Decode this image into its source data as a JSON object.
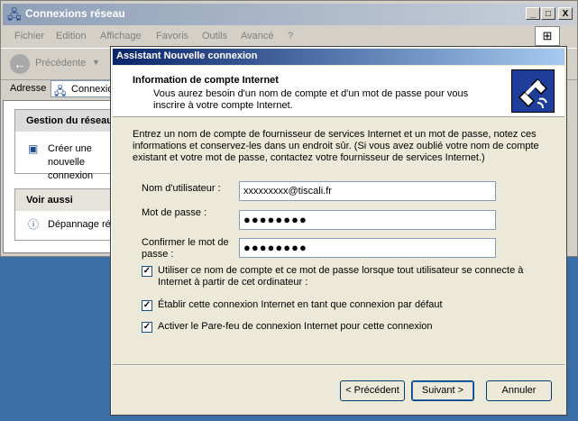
{
  "bg_window": {
    "title": "Connexions réseau",
    "minimize": "_",
    "maximize": "□",
    "close": "X",
    "menu": [
      "Fichier",
      "Edition",
      "Affichage",
      "Favoris",
      "Outils",
      "Avancé",
      "?"
    ],
    "back_label": "Précédente",
    "address_label": "Adresse",
    "address_value": "Connexio",
    "task_panel_title": "Gestion du réseau",
    "task_create": "Créer une nouvelle connexion",
    "see_also_title": "Voir aussi",
    "see_also_item": "Dépannage ré"
  },
  "dialog": {
    "title": "Assistant Nouvelle connexion",
    "header_title": "Information de compte Internet",
    "header_subtitle": "Vous aurez besoin d'un nom de compte et d'un mot de passe pour vous inscrire à votre compte Internet.",
    "intro": "Entrez un nom de compte de fournisseur de services Internet et un mot de passe, notez ces informations et conservez-les dans un endroit sûr. (Si vous avez oublié votre nom de compte existant et votre mot de passe, contactez votre fournisseur de services Internet.)",
    "username_label": "Nom d'utilisateur :",
    "username_value": "xxxxxxxxx@tiscali.fr",
    "password_label": "Mot de passe :",
    "password_value": "●●●●●●●●",
    "confirm_label": "Confirmer le mot de passe :",
    "confirm_value": "●●●●●●●●",
    "check_all_users": "Utiliser ce nom de compte et ce mot de passe lorsque tout utilisateur se connecte à Internet à partir de cet ordinateur :",
    "check_default": "Établir cette connexion Internet en tant que connexion par défaut",
    "check_firewall": "Activer le Pare-feu de connexion Internet pour cette connexion",
    "checked_mark": "✓",
    "btn_back": "< Précédent",
    "btn_next": "Suivant >",
    "btn_cancel": "Annuler"
  }
}
